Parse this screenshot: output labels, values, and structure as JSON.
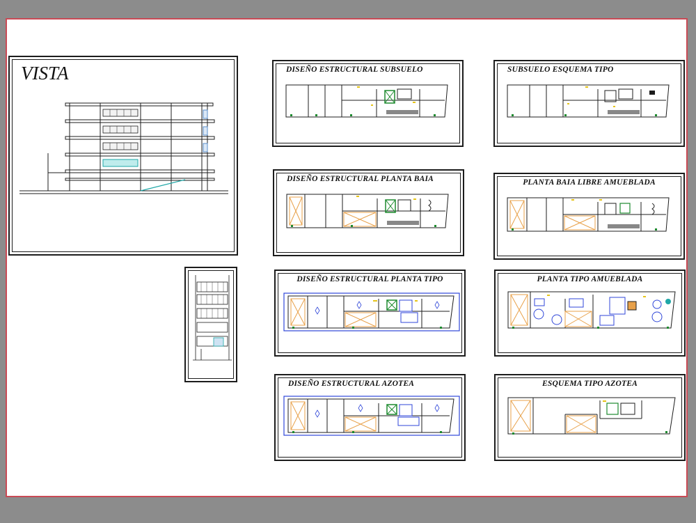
{
  "drawing": {
    "vista_title": "VISTA",
    "panels": [
      {
        "id": "p1",
        "title": "DISEÑO ESTRUCTURAL SUBSUELO"
      },
      {
        "id": "p2",
        "title": "SUBSUELO ESQUEMA TIPO"
      },
      {
        "id": "p3",
        "title": "DISEÑO ESTRUCTURAL PLANTA BAIA"
      },
      {
        "id": "p4",
        "title": "PLANTA BAIA LIBRE AMUEBLADA"
      },
      {
        "id": "p5",
        "title": "DISEÑO ESTRUCTURAL PLANTA TIPO"
      },
      {
        "id": "p6",
        "title": "PLANTA TIPO AMUEBLADA"
      },
      {
        "id": "p7",
        "title": "DISEÑO ESTRUCTURAL AZOTEA"
      },
      {
        "id": "p8",
        "title": "ESQUEMA TIPO AZOTEA"
      }
    ],
    "colors": {
      "line": "#1c1c1c",
      "green": "#1d8a2e",
      "yellow": "#e6c419",
      "orange": "#e8a14a",
      "blue": "#2f46d8",
      "cyan": "#1fa7a7",
      "sheet_border": "#c94a55"
    }
  }
}
